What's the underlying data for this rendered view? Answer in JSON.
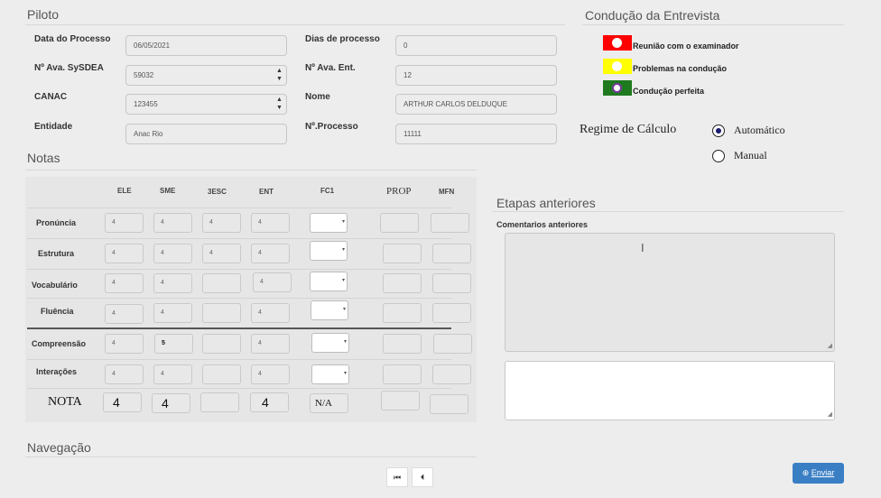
{
  "piloto": {
    "title": "Piloto",
    "data_processo_label": "Data do Processo",
    "data_processo_value": "06/05/2021",
    "dias_processo_label": "Dias de processo",
    "dias_processo_value": "0",
    "ava_sysdea_label": "Nº Ava. SySDEA",
    "ava_sysdea_value": "59032",
    "ava_ent_label": "Nº Ava. Ent.",
    "ava_ent_value": "12",
    "canac_label": "CANAC",
    "canac_value": "123455",
    "nome_label": "Nome",
    "nome_value": "ARTHUR CARLOS DELDUQUE",
    "entidade_label": "Entidade",
    "entidade_value": "Anac Rio",
    "processo_label": "Nº.Processo",
    "processo_value": "11111"
  },
  "conducao": {
    "title": "Condução da Entrevista",
    "items": [
      {
        "label": "Reunião com o examinador",
        "color": "#ff0000"
      },
      {
        "label": "Problemas na condução",
        "color": "#ffff00"
      },
      {
        "label": "Condução perfeita",
        "color": "#1f7a1f"
      }
    ]
  },
  "regime": {
    "label": "Regime de Cálculo",
    "options": [
      "Automático",
      "Manual"
    ],
    "selected": "Automático"
  },
  "notas": {
    "title": "Notas",
    "columns": [
      "ELE",
      "SME",
      "3ESC",
      "ENT",
      "FC1",
      "PROP",
      "MFN"
    ],
    "rows": [
      {
        "label": "Pronúncia",
        "ele": "4",
        "sme": "4",
        "esc": "4",
        "ent": "4"
      },
      {
        "label": "Estrutura",
        "ele": "4",
        "sme": "4",
        "esc": "4",
        "ent": "4"
      },
      {
        "label": "Vocabulário",
        "ele": "4",
        "sme": "4",
        "esc": "",
        "ent": "4"
      },
      {
        "label": "Fluência",
        "ele": "4",
        "sme": "4",
        "esc": "",
        "ent": "4"
      },
      {
        "label": "Compreensão",
        "ele": "4",
        "sme": "5",
        "esc": "",
        "ent": "4"
      },
      {
        "label": "Interações",
        "ele": "4",
        "sme": "4",
        "esc": "",
        "ent": "4"
      }
    ],
    "nota_label": "NOTA",
    "nota_values": {
      "ele": "4",
      "sme": "4",
      "esc": "",
      "ent": "4",
      "fc1": "N/A"
    }
  },
  "etapas": {
    "title": "Etapas anteriores",
    "comentarios_label": "Comentarios anteriores"
  },
  "navegacao": {
    "title": "Navegação",
    "first_icon": "first-page-icon",
    "prev_icon": "prev-page-icon"
  },
  "enviar": {
    "label": "Enviar",
    "icon": "arrow-circle-up-icon",
    "color": "#3a7fc4"
  }
}
